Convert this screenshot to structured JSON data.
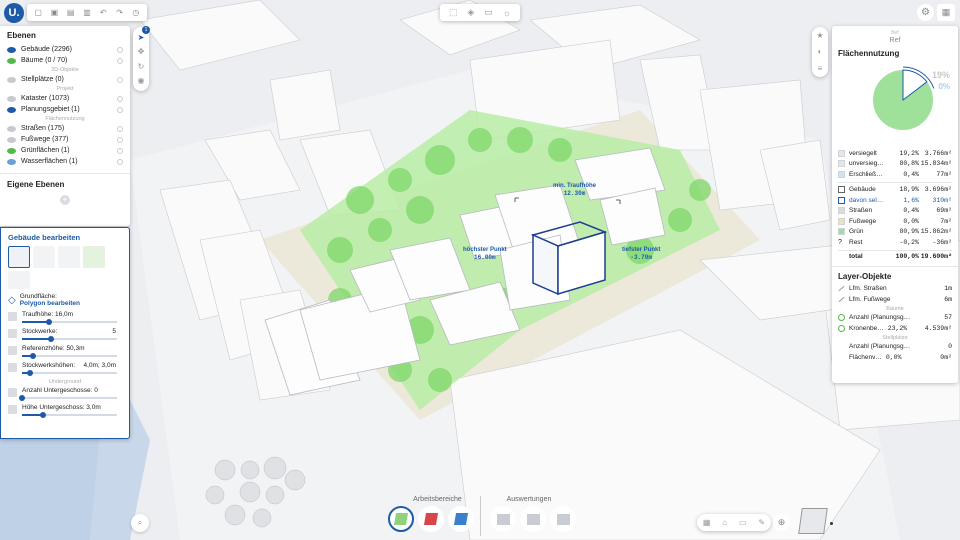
{
  "app": {
    "logo": "U."
  },
  "map": {
    "labels": {
      "traufhoehe_title": "min. Traufhöhe",
      "traufhoehe_value": "12.30m",
      "hoechster_title": "höchster Punkt",
      "hoechster_value": "16.00m",
      "tiefster_title": "tiefster Punkt",
      "tiefster_value": "-3.70m"
    }
  },
  "layers": {
    "title": "Ebenen",
    "items": [
      {
        "label": "Gebäude (2296)",
        "active": true
      },
      {
        "label": "Bäume (0 / 70)",
        "active": true
      },
      {
        "caption": "2D-Objekte"
      },
      {
        "label": "Stellplätze (0)",
        "active": false
      },
      {
        "caption": "Projekt"
      },
      {
        "label": "Kataster (1073)",
        "active": false
      },
      {
        "label": "Planungsgebiet (1)",
        "active": true
      },
      {
        "caption": "Flächennutzung"
      },
      {
        "label": "Straßen (175)",
        "active": false
      },
      {
        "label": "Fußwege (377)",
        "active": false
      },
      {
        "label": "Grünflächen (1)",
        "active": true
      },
      {
        "label": "Wasserflächen (1)",
        "active": true
      }
    ],
    "own_title": "Eigene Ebenen"
  },
  "building_edit": {
    "title": "Gebäude bearbeiten",
    "grundflaeche_label": "Grundfläche:",
    "grundflaeche_link": "Polygon bearbeiten",
    "params": [
      {
        "label": "Traufhöhe: 16,0m",
        "value": 0.28
      },
      {
        "label": "Stockwerke:",
        "extra": "5",
        "value": 0.3
      },
      {
        "label": "Referenzhöhe: 50,3m",
        "value": 0.12
      },
      {
        "label": "Stockwerkshöhen:",
        "extra": "4,0m; 3,0m",
        "value": 0.08
      },
      {
        "caption": "Underground"
      },
      {
        "label": "Anzahl Untergeschosse: 0",
        "value": 0.0
      },
      {
        "label": "Höhe Untergeschoss: 3,0m",
        "value": 0.22
      }
    ]
  },
  "toolbar_top": {
    "undo": "↶",
    "redo": "↷"
  },
  "ref": {
    "label": "Ref"
  },
  "flaechennutzung": {
    "title": "Flächennutzung",
    "pie_pct_top": "19%",
    "pie_pct_bottom": "0%",
    "rows": [
      {
        "name": "versiegelt",
        "pct": "19,2%",
        "area": "3.766m²",
        "color": "#e6e6e6"
      },
      {
        "name": "unversieg…",
        "pct": "80,8%",
        "area": "15.834m²",
        "color": "#e6e6e6"
      },
      {
        "name": "Erschließ…",
        "pct": "0,4%",
        "area": "77m²",
        "color": "#cfe3f5"
      },
      {
        "divider": true
      },
      {
        "name": "Gebäude",
        "pct": "18,9%",
        "area": "3.696m²",
        "color": "#ffffff",
        "outline": "#666"
      },
      {
        "name": "davon sel…",
        "pct": "1,6%",
        "area": "310m²",
        "color": "#ffffff",
        "outline": "#1e5aa8",
        "highlight": true
      },
      {
        "name": "Straßen",
        "pct": "0,4%",
        "area": "69m²",
        "color": "#dcdcdc"
      },
      {
        "name": "Fußwege",
        "pct": "0,0%",
        "area": "7m²",
        "color": "#f3e2b8"
      },
      {
        "name": "Grün",
        "pct": "80,9%",
        "area": "15.862m²",
        "color": "#9fe09a"
      },
      {
        "name": "Rest",
        "pct": "-0,2%",
        "area": "-36m²",
        "color": "#ffffff",
        "q": true
      },
      {
        "name": "total",
        "pct": "100,0%",
        "area": "19.600m²",
        "total": true
      }
    ]
  },
  "layer_objects": {
    "title": "Layer-Objekte",
    "rows": [
      {
        "name": "Lfm. Straßen",
        "value": "1m",
        "icon": "line"
      },
      {
        "name": "Lfm. Fußwege",
        "value": "6m",
        "icon": "line"
      },
      {
        "caption": "Bäume"
      },
      {
        "name": "Anzahl (Planungsg…",
        "value": "57",
        "icon": "circle"
      },
      {
        "name": "Kronenbe…",
        "pct": "23,2%",
        "value": "4.539m²",
        "icon": "circle"
      },
      {
        "caption": "Stellplätze"
      },
      {
        "name": "Anzahl (Planungsg…",
        "value": "0",
        "icon": "none"
      },
      {
        "name": "Flächenv…",
        "pct": "0,0%",
        "value": "0m²",
        "icon": "none"
      }
    ]
  },
  "bottom": {
    "arbeitsbereiche": "Arbeitsbereiche",
    "auswertungen": "Auswertungen"
  },
  "colors": {
    "accent": "#1e5aa8",
    "green": "#9fe09a",
    "panel": "#ffffff"
  }
}
